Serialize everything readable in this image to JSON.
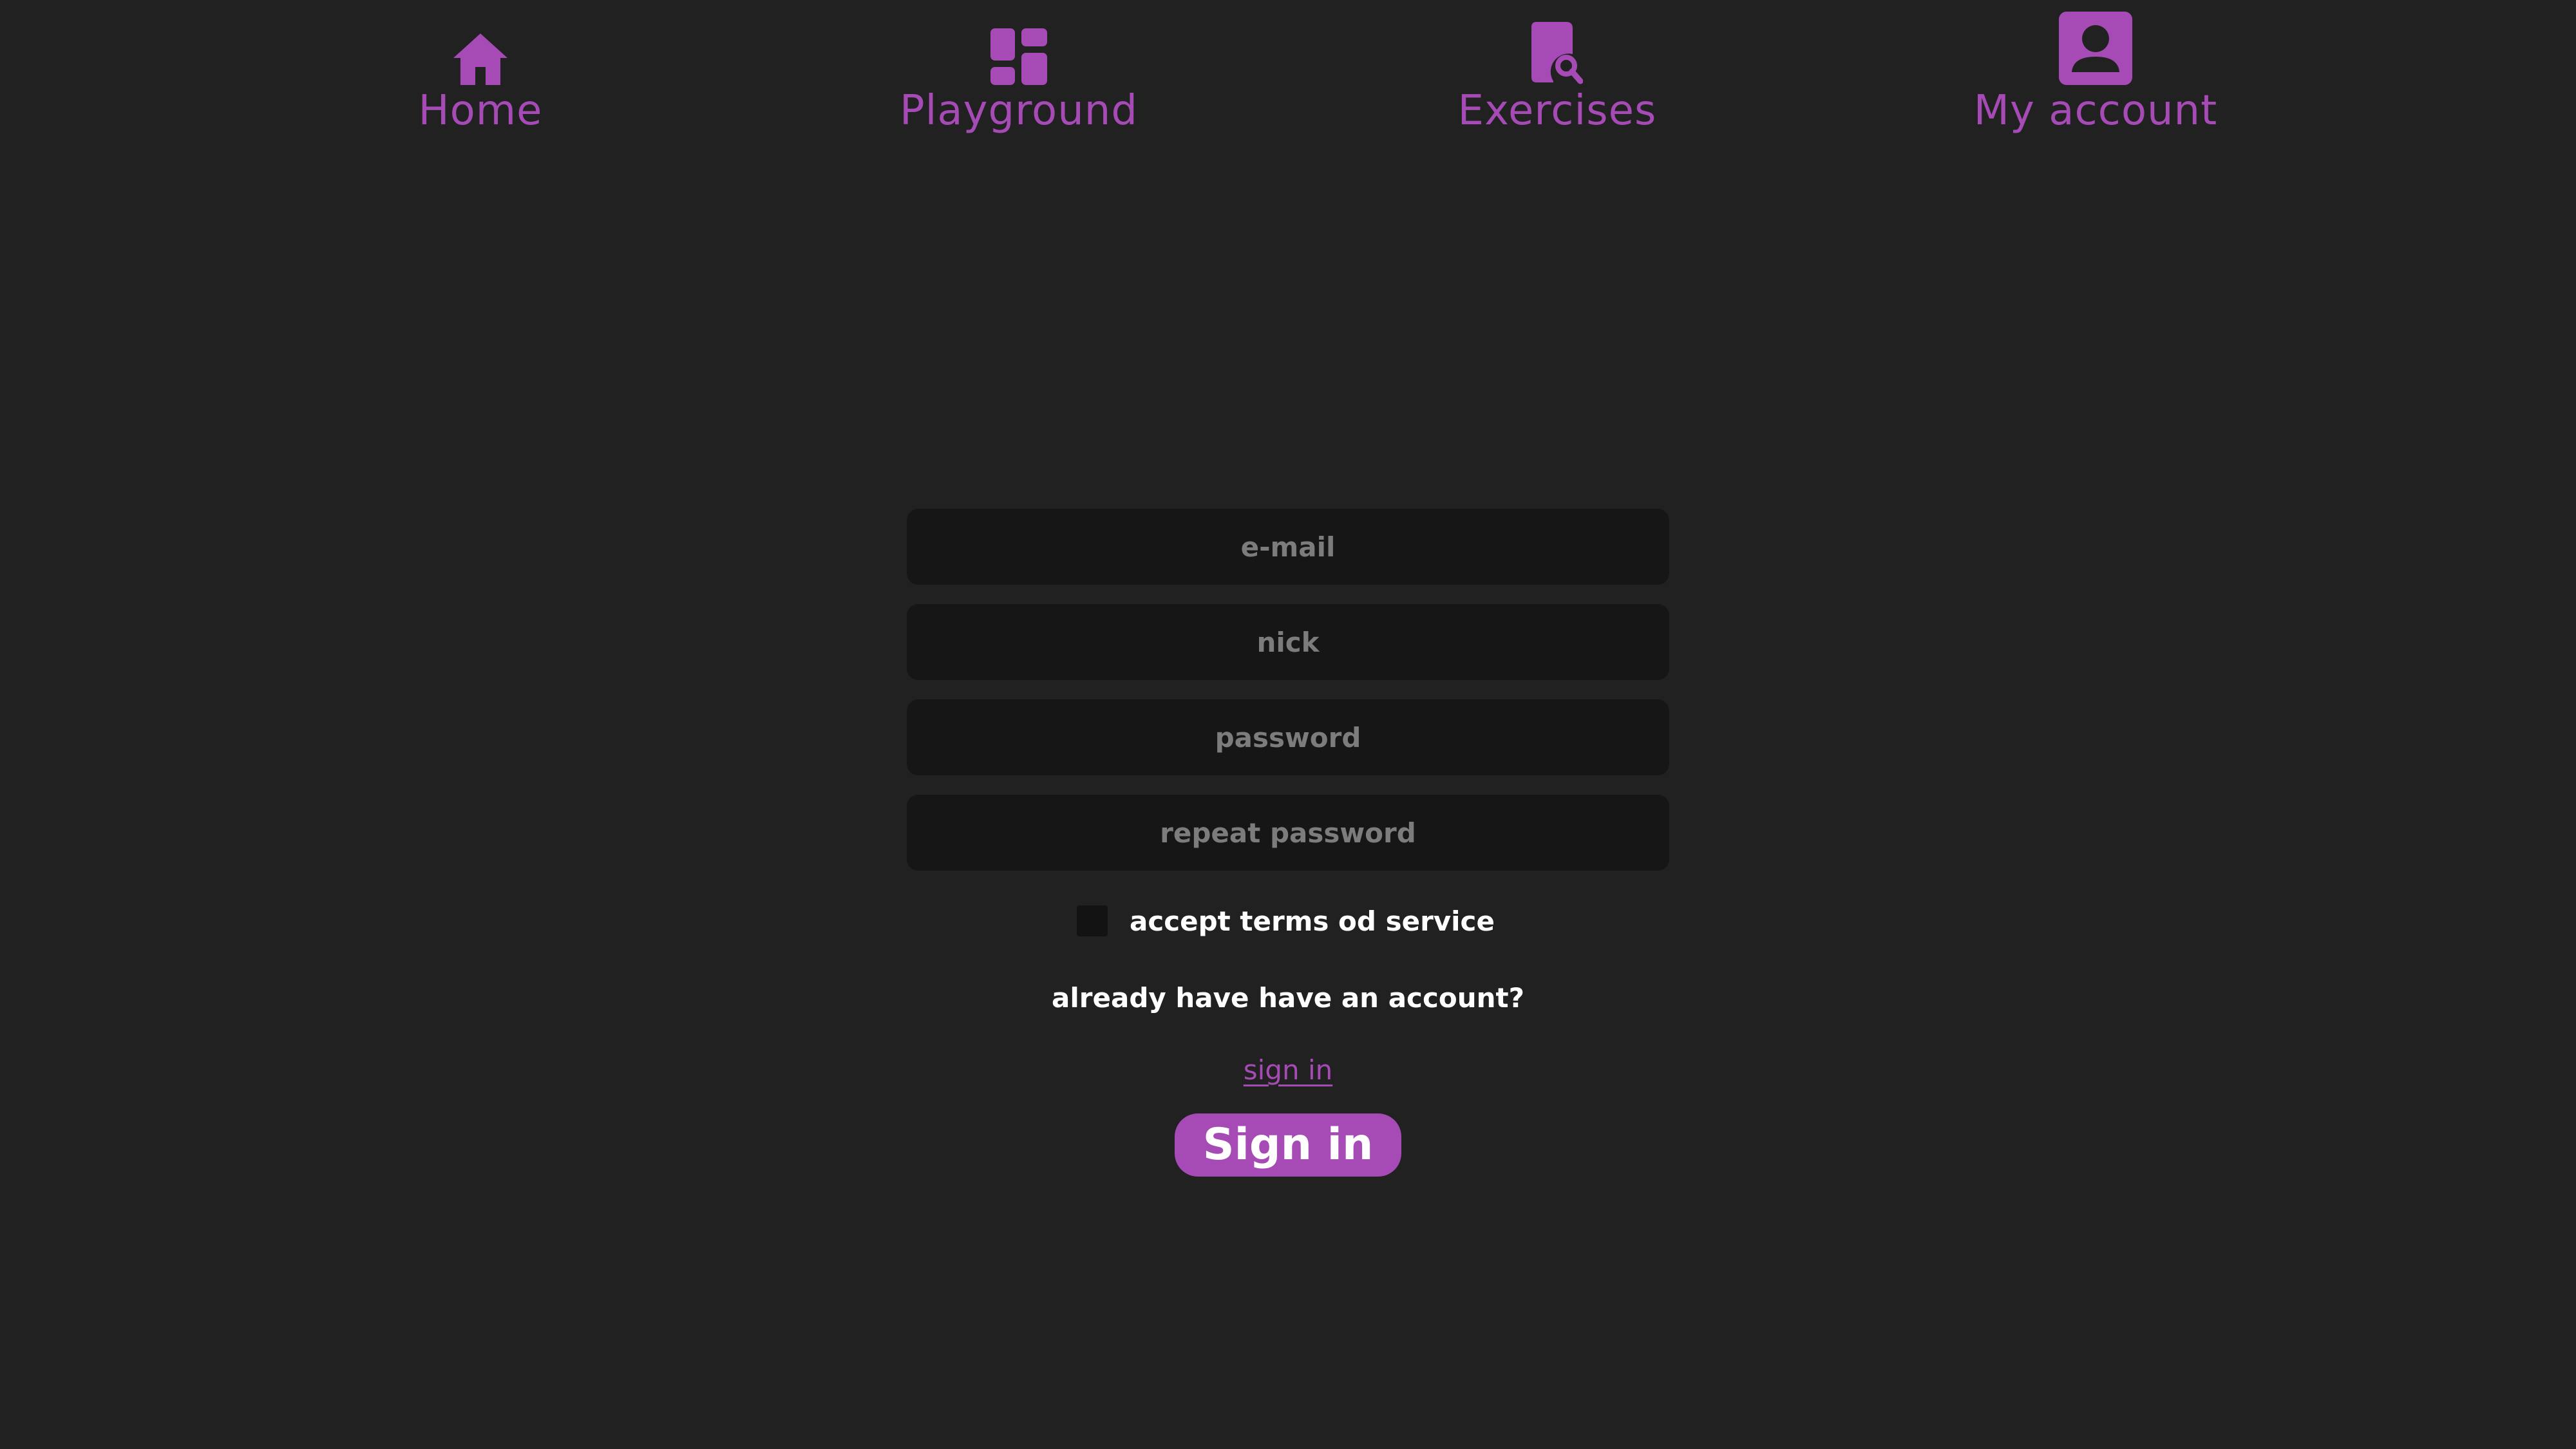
{
  "colors": {
    "background": "#212121",
    "accent": "#a64bb6",
    "field_background": "#161616",
    "placeholder": "#7c7c7c",
    "text": "#ffffff"
  },
  "nav": {
    "items": [
      {
        "label": "Home",
        "icon": "home-icon"
      },
      {
        "label": "Playground",
        "icon": "dashboard-icon"
      },
      {
        "label": "Exercises",
        "icon": "document-search-icon"
      },
      {
        "label": "My account",
        "icon": "account-box-icon"
      }
    ]
  },
  "form": {
    "email_placeholder": "e-mail",
    "email_value": "",
    "nick_placeholder": "nick",
    "nick_value": "",
    "password_placeholder": "password",
    "password_value": "",
    "repeat_password_placeholder": "repeat password",
    "repeat_password_value": "",
    "terms_label": "accept terms od service",
    "terms_checked": false,
    "already_text": "already have have an account?",
    "signin_link": "sign in",
    "signin_button": "Sign in"
  }
}
